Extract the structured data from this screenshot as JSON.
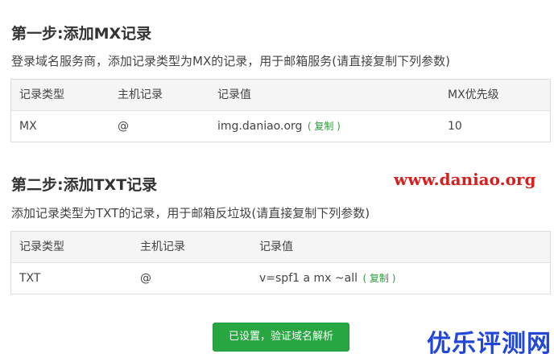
{
  "step1": {
    "title": "第一步:添加MX记录",
    "description": "登录域名服务商，添加记录类型为MX的记录，用于邮箱服务(请直接复制下列参数)",
    "headers": [
      "记录类型",
      "主机记录",
      "记录值",
      "MX优先级"
    ],
    "row": {
      "type": "MX",
      "host": "@",
      "value": "img.daniao.org",
      "copy_label": "( 复制 )",
      "priority": "10"
    }
  },
  "step2": {
    "title": "第二步:添加TXT记录",
    "description": "添加记录类型为TXT的记录，用于邮箱反垃圾(请直接复制下列参数)",
    "headers": [
      "记录类型",
      "主机记录",
      "记录值"
    ],
    "row": {
      "type": "TXT",
      "host": "@",
      "value": "v=spf1 a mx ~all",
      "copy_label": "( 复制 )"
    }
  },
  "verify_button_label": "已设置，验证域名解析",
  "watermarks": {
    "url": "www.daniao.org",
    "brand": "优乐评测网"
  },
  "colors": {
    "copy_link": "#2c9b3c",
    "button_bg": "#27a642",
    "watermark_url": "#d62020",
    "watermark_brand": "#2247d8"
  }
}
